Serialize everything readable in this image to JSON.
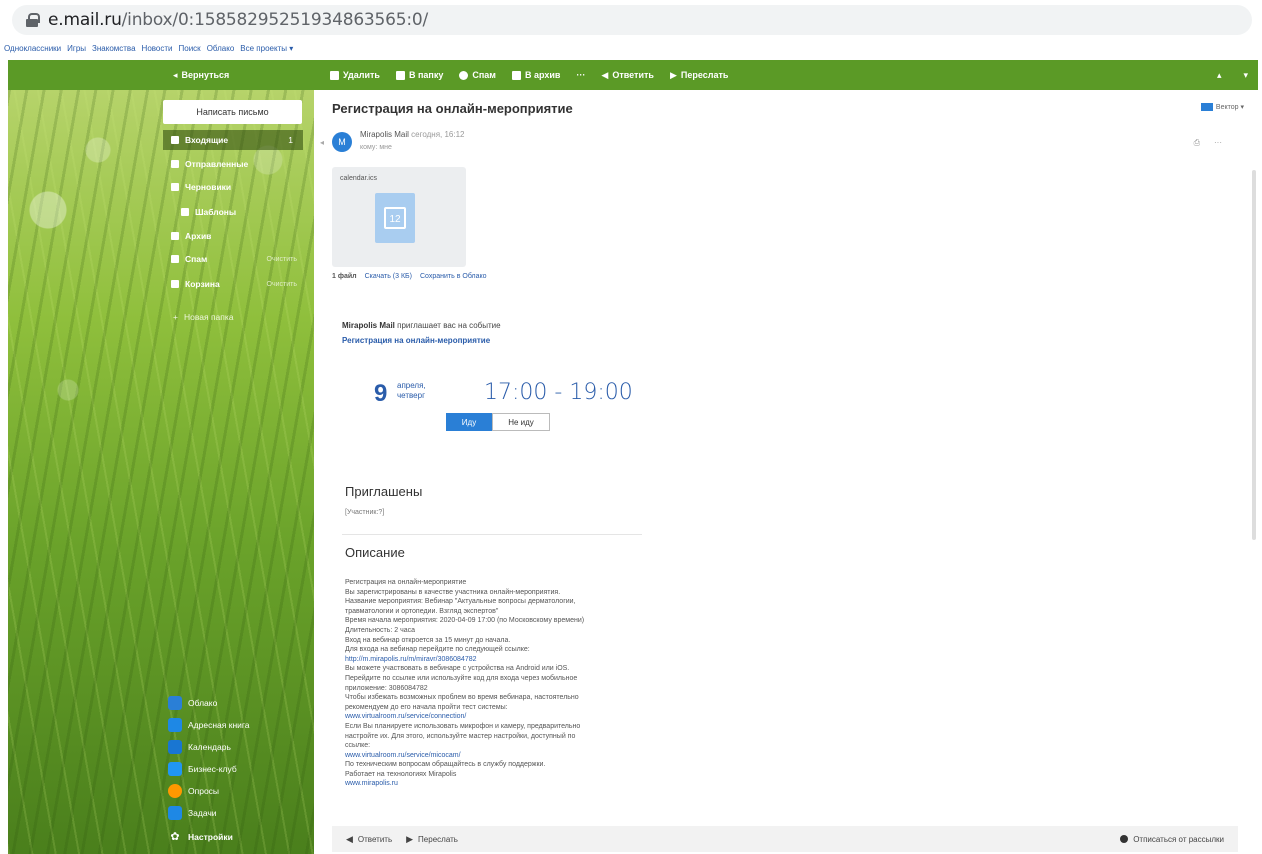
{
  "browser": {
    "url_host": "e.mail.ru",
    "url_path": "/inbox/0:15858295251934863565:0/"
  },
  "portal_links": [
    "Одноклассники",
    "Игры",
    "Знакомства",
    "Новости",
    "Поиск",
    "Облако",
    "Все проекты ▾"
  ],
  "toolbar": {
    "back": "Вернуться",
    "delete": "Удалить",
    "to_folder": "В папку",
    "spam": "Спам",
    "archive": "В архив",
    "more": "···",
    "reply": "Ответить",
    "forward": "Переслать",
    "right_a": "▴",
    "right_b": "▾"
  },
  "sidebar": {
    "compose": "Написать письмо",
    "folders": [
      {
        "label": "Входящие",
        "count": "1",
        "clear": ""
      },
      {
        "label": "Отправленные",
        "count": "",
        "clear": ""
      },
      {
        "label": "Черновики",
        "count": "",
        "clear": ""
      },
      {
        "label": "Шаблоны",
        "count": "",
        "clear": ""
      },
      {
        "label": "Архив",
        "count": "",
        "clear": ""
      },
      {
        "label": "Спам",
        "count": "",
        "clear": "Очистить"
      },
      {
        "label": "Корзина",
        "count": "",
        "clear": "Очистить"
      }
    ],
    "new_folder": "Новая папка",
    "bottom_links": [
      "Облако",
      "Адресная книга",
      "Календарь",
      "Бизнес-клуб",
      "Опросы",
      "Задачи",
      "Настройки"
    ]
  },
  "message": {
    "subject": "Регистрация на онлайн-мероприятие",
    "themes": "Вектор ▾",
    "sender": "Mirapolis Mail",
    "time": "сегодня, 16:12",
    "to": "кому: мне",
    "avatar_letter": "M",
    "attachment": {
      "name": "calendar.ics",
      "icon_day": "12",
      "count": "1 файл",
      "download": "Скачать (3 КБ)",
      "save": "Сохранить в Облако"
    },
    "invite_sender": "Mirapolis Mail",
    "invite_text": "приглашает вас на событие",
    "event_title": "Регистрация на онлайн-мероприятие",
    "day": "9",
    "month": "апреля,",
    "weekday": "четверг",
    "time_range": "17:00 - 19:00",
    "rsvp_yes": "Иду",
    "rsvp_no": "Не иду",
    "invited_heading": "Приглашены",
    "participants": "[Участник:?]",
    "description_heading": "Описание",
    "description_lines": [
      {
        "text": "Регистрация на онлайн-мероприятие",
        "link": false
      },
      {
        "text": "Вы зарегистрированы в качестве участника онлайн-мероприятия.",
        "link": false
      },
      {
        "text": "Название мероприятия: Вебинар \"Актуальные вопросы дерматологии,",
        "link": false
      },
      {
        "text": "травматологии и ортопедии. Взгляд экспертов\"",
        "link": false
      },
      {
        "text": "Время начала мероприятия: 2020-04-09 17:00 (по Московскому времени)",
        "link": false
      },
      {
        "text": "Длительность: 2 часа",
        "link": false
      },
      {
        "text": "Вход на вебинар откроется за 15 минут до начала.",
        "link": false
      },
      {
        "text": "Для входа на вебинар перейдите по следующей ссылке:",
        "link": false
      },
      {
        "text": "http://m.mirapolis.ru/m/miravr/3086084782",
        "link": true
      },
      {
        "text": "Вы можете участвовать в вебинаре с устройства на Android или iOS.",
        "link": false
      },
      {
        "text": "Перейдите по ссылке или используйте код для входа через мобильное",
        "link": false
      },
      {
        "text": "приложение: 3086084782",
        "link": false
      },
      {
        "text": "Чтобы избежать возможных проблем во время вебинара, настоятельно",
        "link": false
      },
      {
        "text": "рекомендуем до его начала пройти тест системы:",
        "link": false
      },
      {
        "text": "www.virtualroom.ru/service/connection/",
        "link": true
      },
      {
        "text": "Если Вы планируете использовать микрофон и камеру, предварительно",
        "link": false
      },
      {
        "text": "настройте их. Для этого, используйте мастер настройки, доступный по",
        "link": false
      },
      {
        "text": "ссылке:",
        "link": false
      },
      {
        "text": "www.virtualroom.ru/service/micocam/",
        "link": true
      },
      {
        "text": "По техническим вопросам обращайтесь в службу поддержки.",
        "link": false
      },
      {
        "text": "Работает на технологиях Mirapolis",
        "link": false
      },
      {
        "text": "www.mirapolis.ru",
        "link": true
      }
    ],
    "footer_reply": "Ответить",
    "footer_forward": "Переслать",
    "unsubscribe": "Отписаться от рассылки"
  }
}
